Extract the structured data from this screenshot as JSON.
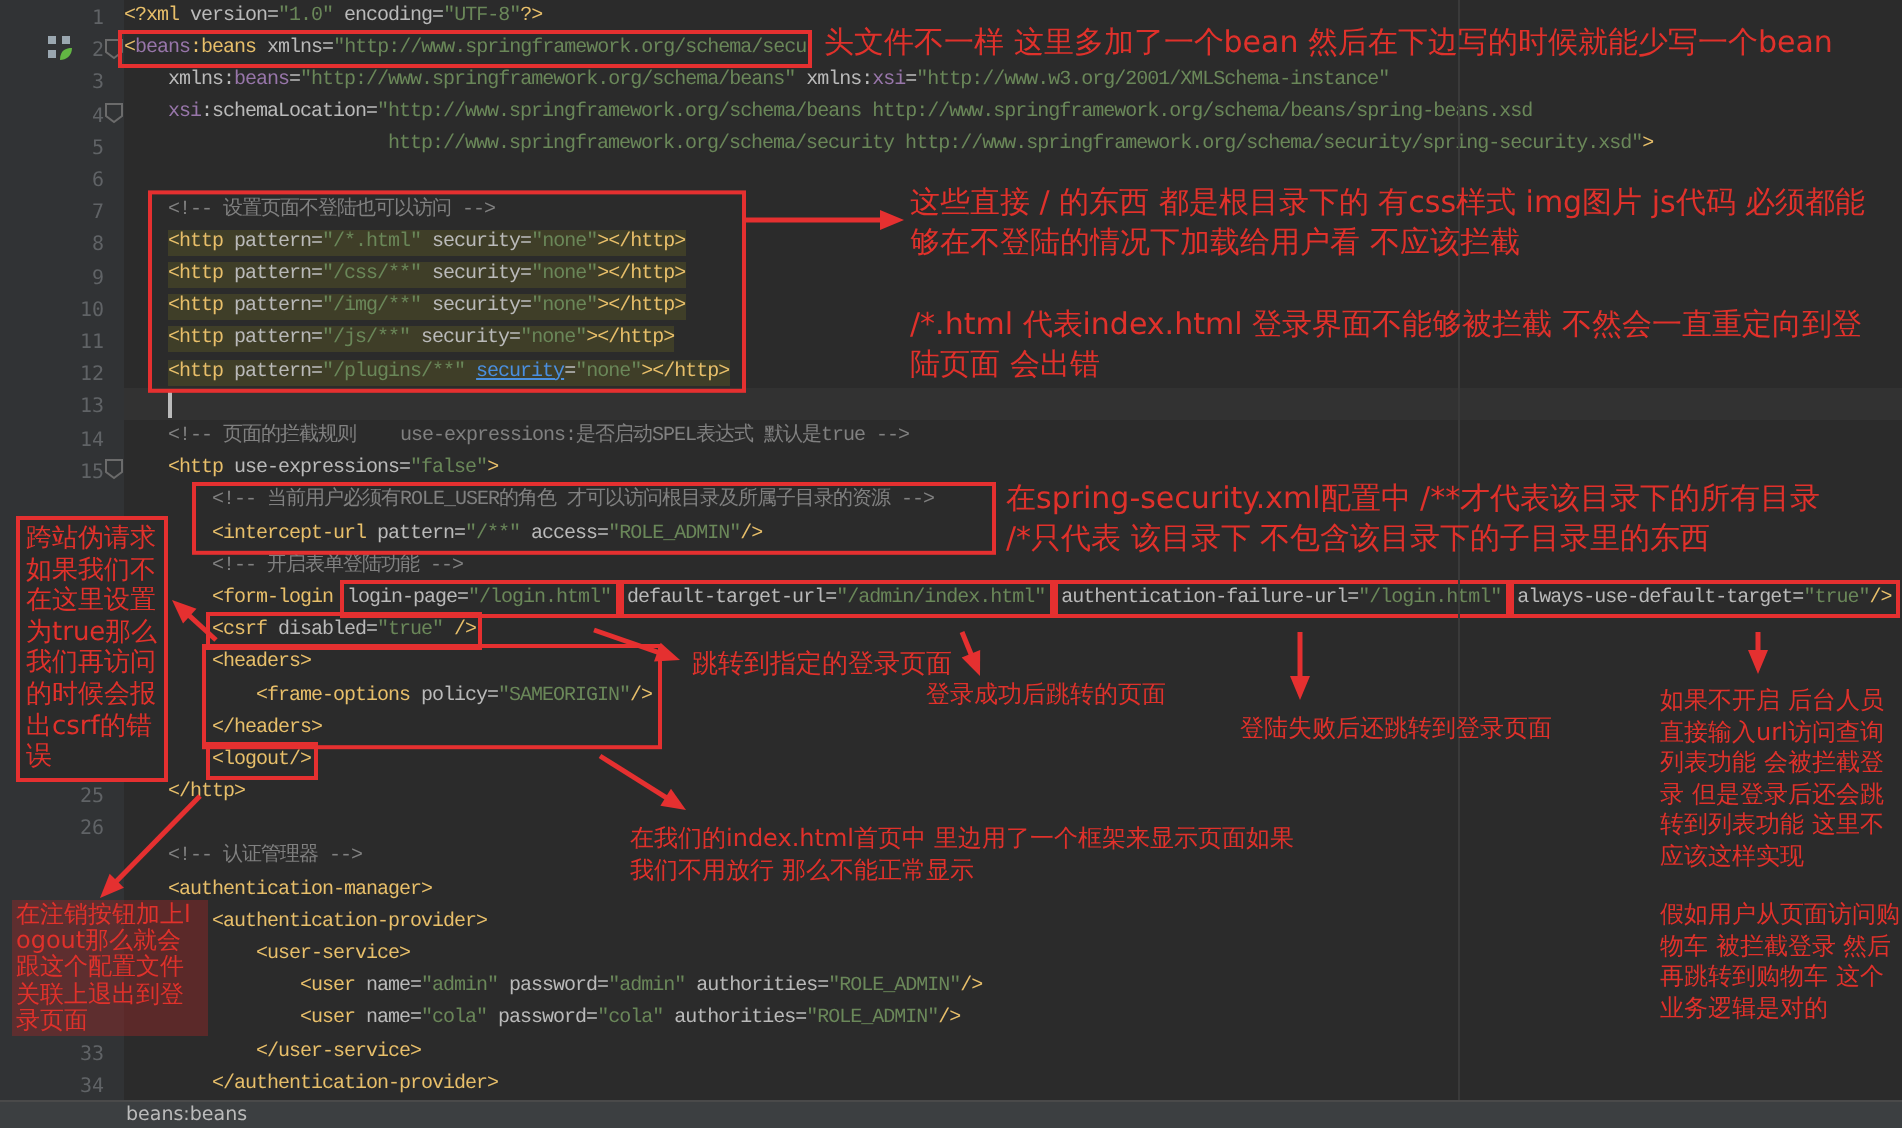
{
  "code": {
    "lines": [
      {
        "number": "1",
        "tokens": [
          {
            "kind": "tag",
            "text": "<?xml"
          },
          {
            "kind": "attr",
            "text": " version="
          },
          {
            "kind": "value",
            "text": "\"1.0\""
          },
          {
            "kind": "attr",
            "text": " encoding="
          },
          {
            "kind": "value",
            "text": "\"UTF-8\""
          },
          {
            "kind": "tag",
            "text": "?>"
          }
        ]
      },
      {
        "number": "2",
        "bean_icon": true,
        "boxed": true,
        "tokens": [
          {
            "kind": "tag",
            "text": "<"
          },
          {
            "kind": "ns",
            "text": "beans"
          },
          {
            "kind": "tag",
            "text": ":beans"
          },
          {
            "kind": "attr",
            "text": " xmlns="
          },
          {
            "kind": "value",
            "text": "\"http://www.springframework.org/schema/secu"
          }
        ],
        "children": [
          {
            "number": "3",
            "tokens": [
              {
                "kind": "attr",
                "text": "xmlns:"
              },
              {
                "kind": "ns",
                "text": "beans"
              },
              {
                "kind": "attr",
                "text": "="
              },
              {
                "kind": "value",
                "text": "\"http://www.springframework.org/schema/beans\""
              },
              {
                "kind": "attr",
                "text": " xmlns:"
              },
              {
                "kind": "ns",
                "text": "xsi"
              },
              {
                "kind": "attr",
                "text": "="
              },
              {
                "kind": "value",
                "text": "\"http://www.w3.org/2001/XMLSchema-instance\""
              }
            ]
          },
          {
            "number": "4",
            "tokens": [
              {
                "kind": "ns",
                "text": "xsi"
              },
              {
                "kind": "attr",
                "text": ":schemaLocation="
              },
              {
                "kind": "value",
                "text": "\"http://www.springframework.org/schema/beans http://www.springframework.org/schema/beans/spring-beans.xsd"
              }
            ],
            "children": [
              {
                "number": "5",
                "tokens": [
                  {
                    "kind": "value",
                    "text": "                http://www.springframework.org/schema/security http://www.springframework.org/schema/security/spring-security.xsd\""
                  },
                  {
                    "kind": "tag",
                    "text": ">"
                  }
                ]
              }
            ]
          },
          {
            "number": "6"
          },
          {
            "number": "7",
            "tokens": [
              {
                "kind": "comment",
                "text": "<!-- 设置页面不登陆也可以访问 -->"
              }
            ]
          },
          {
            "number": "8",
            "highlighted": true,
            "tokens": [
              {
                "kind": "tag",
                "text": "<http"
              },
              {
                "kind": "attr",
                "text": " pattern="
              },
              {
                "kind": "value",
                "text": "\"/*.html\""
              },
              {
                "kind": "attr",
                "text": " security="
              },
              {
                "kind": "value",
                "text": "\"none\""
              },
              {
                "kind": "tag",
                "text": "></http>"
              }
            ]
          },
          {
            "number": "9",
            "highlighted": true,
            "tokens": [
              {
                "kind": "tag",
                "text": "<http"
              },
              {
                "kind": "attr",
                "text": " pattern="
              },
              {
                "kind": "value",
                "text": "\"/css/**\""
              },
              {
                "kind": "attr",
                "text": " security="
              },
              {
                "kind": "value",
                "text": "\"none\""
              },
              {
                "kind": "tag",
                "text": "></http>"
              }
            ]
          },
          {
            "number": "10",
            "highlighted": true,
            "tokens": [
              {
                "kind": "tag",
                "text": "<http"
              },
              {
                "kind": "attr",
                "text": " pattern="
              },
              {
                "kind": "value",
                "text": "\"/img/**\""
              },
              {
                "kind": "attr",
                "text": " security="
              },
              {
                "kind": "value",
                "text": "\"none\""
              },
              {
                "kind": "tag",
                "text": "></http>"
              }
            ]
          },
          {
            "number": "11",
            "highlighted": true,
            "tokens": [
              {
                "kind": "tag",
                "text": "<http"
              },
              {
                "kind": "attr",
                "text": " pattern="
              },
              {
                "kind": "value",
                "text": "\"/js/**\""
              },
              {
                "kind": "attr",
                "text": " security="
              },
              {
                "kind": "value",
                "text": "\"none\""
              },
              {
                "kind": "tag",
                "text": "></http>"
              }
            ]
          },
          {
            "number": "12",
            "highlighted": true,
            "tokens": [
              {
                "kind": "tag",
                "text": "<http"
              },
              {
                "kind": "attr",
                "text": " pattern="
              },
              {
                "kind": "value",
                "text": "\"/plugins/**\" "
              },
              {
                "kind": "ref",
                "text": "security"
              },
              {
                "kind": "attr",
                "text": "="
              },
              {
                "kind": "value",
                "text": "\"none\""
              },
              {
                "kind": "tag",
                "text": "></http>"
              }
            ]
          },
          {
            "number": "13",
            "current": true
          },
          {
            "number": "14",
            "tokens": [
              {
                "kind": "comment",
                "text": "<!-- 页面的拦截规则    use-expressions:是否启动SPEL表达式 默认是true -->"
              }
            ]
          },
          {
            "number": "15",
            "tokens": [
              {
                "kind": "tag",
                "text": "<http"
              },
              {
                "kind": "attr",
                "text": " use-expressions="
              },
              {
                "kind": "value",
                "text": "\"false\""
              },
              {
                "kind": "tag",
                "text": ">"
              }
            ],
            "children": [
              {
                "tokens": [
                  {
                    "kind": "comment",
                    "text": "<!-- 当前用户必须有ROLE_USER的角色 才可以访问根目录及所属子目录的资源 -->"
                  }
                ]
              },
              {
                "tokens": [
                  {
                    "kind": "tag",
                    "text": "<intercept-url"
                  },
                  {
                    "kind": "attr",
                    "text": " pattern="
                  },
                  {
                    "kind": "value",
                    "text": "\"/**\""
                  },
                  {
                    "kind": "attr",
                    "text": " access="
                  },
                  {
                    "kind": "value",
                    "text": "\"ROLE_ADMIN\""
                  },
                  {
                    "kind": "tag",
                    "text": "/>"
                  }
                ]
              },
              {
                "tokens": [
                  {
                    "kind": "comment",
                    "text": "<!-- 开启表单登陆功能 -->"
                  }
                ]
              },
              {
                "tokens": [
                  {
                    "kind": "tag",
                    "text": "<form-login"
                  },
                  {
                    "boxed": true,
                    "tokens": [
                      {
                        "kind": "attr",
                        "text": "login-page="
                      },
                      {
                        "kind": "value",
                        "text": "\"/login.html\""
                      }
                    ]
                  },
                  {
                    "boxed": true,
                    "tokens": [
                      {
                        "kind": "attr",
                        "text": "default-target-url="
                      },
                      {
                        "kind": "value",
                        "text": "\"/admin/index.html\""
                      }
                    ]
                  },
                  {
                    "boxed": true,
                    "tokens": [
                      {
                        "kind": "attr",
                        "text": "authentication-failure-url="
                      },
                      {
                        "kind": "value",
                        "text": "\"/login.html\""
                      }
                    ]
                  },
                  {
                    "boxed": true,
                    "tokens": [
                      {
                        "kind": "attr",
                        "text": "always-use-default-target="
                      },
                      {
                        "kind": "value",
                        "text": "\"true\""
                      },
                      {
                        "kind": "tag",
                        "text": "/>"
                      }
                    ]
                  }
                ]
              },
              {
                "boxed": true,
                "tokens": [
                  {
                    "kind": "tag",
                    "text": "<csrf"
                  },
                  {
                    "kind": "attr",
                    "text": " disabled="
                  },
                  {
                    "kind": "value",
                    "text": "\"true\""
                  },
                  {
                    "kind": "tag",
                    "text": " />"
                  }
                ]
              },
              {
                "tokens": [
                  {
                    "kind": "tag",
                    "text": "<headers>"
                  }
                ],
                "children": [
                  {
                    "tokens": [
                      {
                        "kind": "tag",
                        "text": "<frame-options"
                      },
                      {
                        "kind": "attr",
                        "text": " policy="
                      },
                      {
                        "kind": "value",
                        "text": "\"SAMEORIGIN\""
                      },
                      {
                        "kind": "tag",
                        "text": "/>"
                      }
                    ]
                  }
                ]
              },
              {
                "tokens": [
                  {
                    "kind": "tag",
                    "text": "</headers>"
                  }
                ]
              },
              {
                "boxed": true,
                "tokens": [
                  {
                    "kind": "tag",
                    "text": "<logout/>"
                  }
                ]
              }
            ]
          },
          {
            "number": "25",
            "tokens": [
              {
                "kind": "tag",
                "text": "</http>"
              }
            ]
          },
          {
            "number": "26"
          },
          {
            "tokens": [
              {
                "kind": "comment",
                "text": "<!-- 认证管理器 -->"
              }
            ]
          },
          {
            "tokens": [
              {
                "kind": "tag",
                "text": "<authentication-manager>"
              }
            ],
            "children": [
              {
                "tokens": [
                  {
                    "kind": "tag",
                    "text": "<authentication-provider>"
                  }
                ],
                "children": [
                  {
                    "tokens": [
                      {
                        "kind": "tag",
                        "text": "<user-service>"
                      }
                    ],
                    "children": [
                      {
                        "tokens": [
                          {
                            "kind": "tag",
                            "text": "<user"
                          },
                          {
                            "kind": "attr",
                            "text": " name="
                          },
                          {
                            "kind": "value",
                            "text": "\"admin\""
                          },
                          {
                            "kind": "attr",
                            "text": " password="
                          },
                          {
                            "kind": "value",
                            "text": "\"admin\""
                          },
                          {
                            "kind": "attr",
                            "text": " authorities="
                          },
                          {
                            "kind": "value",
                            "text": "\"ROLE_ADMIN\""
                          },
                          {
                            "kind": "tag",
                            "text": "/>"
                          }
                        ]
                      },
                      {
                        "tokens": [
                          {
                            "kind": "tag",
                            "text": "<user"
                          },
                          {
                            "kind": "attr",
                            "text": " name="
                          },
                          {
                            "kind": "value",
                            "text": "\"cola\""
                          },
                          {
                            "kind": "attr",
                            "text": " password="
                          },
                          {
                            "kind": "value",
                            "text": "\"cola\""
                          },
                          {
                            "kind": "attr",
                            "text": " authorities="
                          },
                          {
                            "kind": "value",
                            "text": "\"ROLE_ADMIN\""
                          },
                          {
                            "kind": "tag",
                            "text": "/>"
                          }
                        ]
                      }
                    ]
                  },
                  {
                    "number": "33",
                    "tokens": [
                      {
                        "kind": "tag",
                        "text": "</user-service>"
                      }
                    ]
                  }
                ]
              },
              {
                "number": "34",
                "tokens": [
                  {
                    "kind": "tag",
                    "text": "</authentication-provider>"
                  }
                ]
              }
            ]
          }
        ]
      }
    ]
  },
  "notes": [
    {
      "text": "头文件不一样 这里多加了一个bean 然后在下边写的时候就能少写一个bean"
    },
    {
      "text": "这些直接 / 的东西 都是根目录下的  有css样式 img图片 js代码 必须都能够在不登陆的情况下加载给用户看  不应该拦截"
    },
    {
      "text": "/*.html 代表index.html 登录界面不能够被拦截  不然会一直重定向到登陆页面 会出错"
    },
    {
      "text": "在spring-security.xml配置中 /**才代表该目录下的所有目录\n/*只代表 该目录下  不包含该目录下的子目录里的东西"
    },
    {
      "text": "跨站伪请求如果我们不在这里设置为true那么我们再访问的时候会报出csrf的错误"
    },
    {
      "text": "跳转到指定的登录页面"
    },
    {
      "text": "登录成功后跳转的页面"
    },
    {
      "text": "登陆失败后还跳转到登录页面"
    },
    {
      "text": "在我们的index.html首页中  里边用了一个框架来显示页面如果我们不用放行  那么不能正常显示"
    },
    {
      "text": "在注销按钮加上logout那么就会跟这个配置文件关联上退出到登录页面"
    },
    {
      "text": "如果不开启 后台人员直接输入url访问查询列表功能 会被拦截登录 但是登录后还会跳转到列表功能 这里不应该这样实现"
    },
    {
      "text": "假如用户从页面访问购物车 被拦截登录 然后再跳转到购物车 这个业务逻辑是对的"
    }
  ],
  "breadcrumb": "beans:beans"
}
